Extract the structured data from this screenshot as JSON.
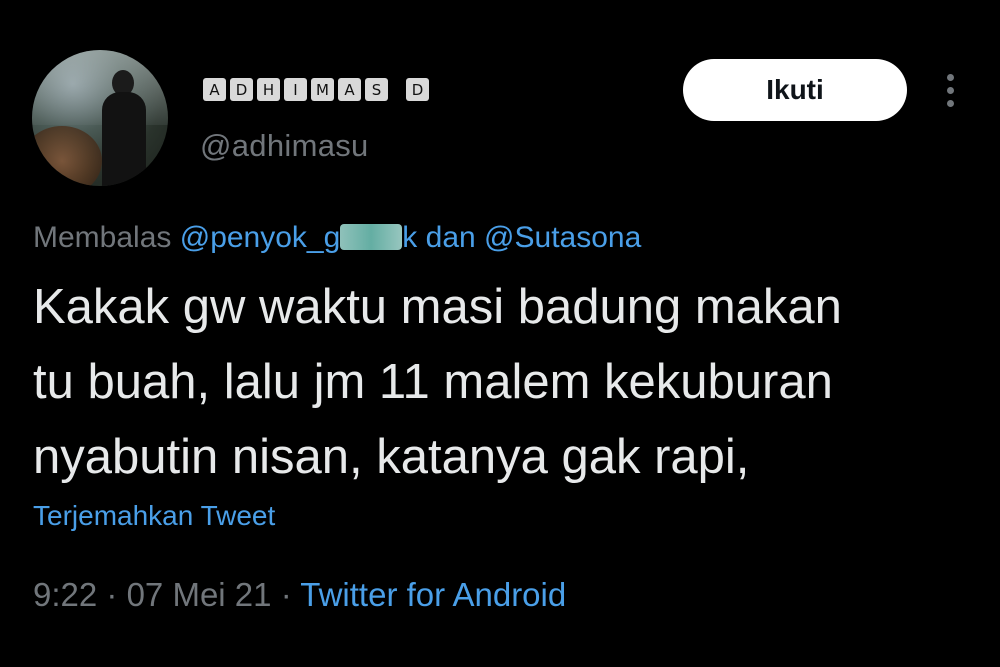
{
  "user": {
    "display_name_letters": [
      "A",
      "D",
      "H",
      "I",
      "M",
      "A",
      "S",
      " ",
      "D"
    ],
    "handle": "@adhimasu"
  },
  "actions": {
    "follow_label": "Ikuti",
    "more_icon": "more-vertical-icon"
  },
  "reply": {
    "prefix": "Membalas",
    "mention1_start": "@penyok_g",
    "mention1_end": "k",
    "connector": "dan",
    "mention2": "@Sutasona"
  },
  "tweet": {
    "lines": [
      "Kakak gw waktu masi badung makan",
      "tu buah, lalu jm 11 malem kekuburan",
      "nyabutin nisan, katanya gak rapi,"
    ],
    "translate_label": "Terjemahkan Tweet"
  },
  "meta": {
    "time": "9:22",
    "date": "07 Mei 21",
    "separator": "·",
    "source": "Twitter for Android"
  },
  "colors": {
    "background": "#000000",
    "text": "#e7e9ea",
    "muted": "#71767b",
    "link": "#4a9fe8",
    "button_bg": "#ffffff"
  }
}
